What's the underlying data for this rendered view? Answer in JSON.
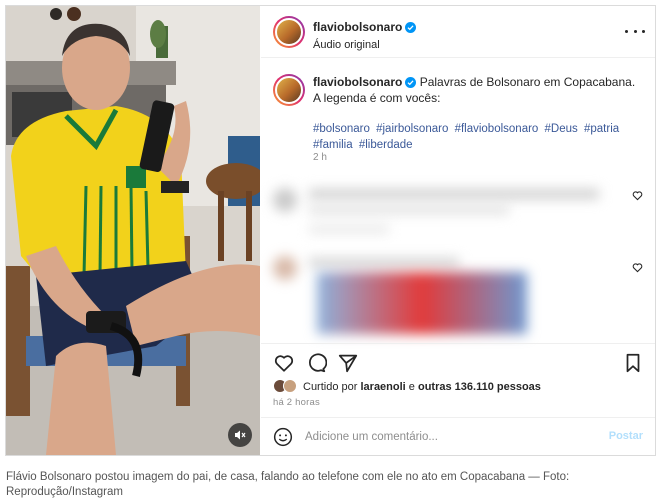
{
  "post": {
    "author": {
      "username": "flaviobolsonaro",
      "verified": true,
      "audio_label": "Áudio original"
    },
    "caption": {
      "username": "flaviobolsonaro",
      "text": "Palavras de Bolsonaro em Copacabana. A legenda é com vocês:",
      "hashtags": [
        "#bolsonaro",
        "#jairbolsonaro",
        "#flaviobolsonaro",
        "#Deus",
        "#patria",
        "#familia",
        "#liberdade"
      ],
      "time": "2 h"
    },
    "actions": {
      "like_icon": "heart-icon",
      "comment_icon": "comment-icon",
      "share_icon": "share-icon",
      "save_icon": "bookmark-icon"
    },
    "likes": {
      "prefix": "Curtido por",
      "user": "laraenoli",
      "middle": "e",
      "others": "outras 136.110 pessoas"
    },
    "posted_time": "há 2 horas",
    "comment_box": {
      "placeholder": "Adicione um comentário...",
      "post_label": "Postar"
    },
    "colors": {
      "hashtag": "#3b5998",
      "verified": "#0095f6",
      "post_button": "#b2dffc",
      "shirt": "#f2d21b",
      "shirt_trim": "#1a7a3a"
    }
  },
  "credit": "Flávio Bolsonaro postou imagem do pai, de casa, falando ao telefone com ele no ato em Copacabana — Foto: Reprodução/Instagram"
}
